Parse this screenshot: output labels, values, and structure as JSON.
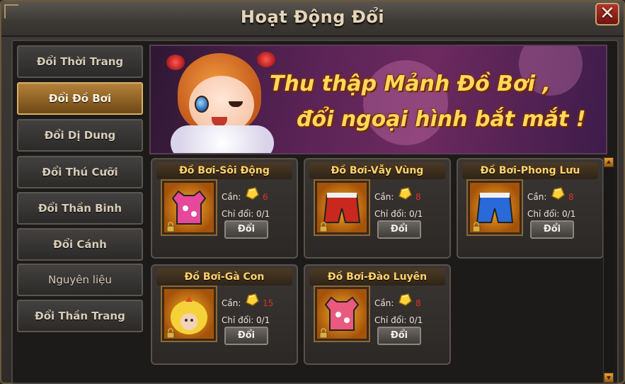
{
  "window": {
    "title": "Hoạt Động Đổi",
    "close_label": "✕"
  },
  "sidebar": {
    "items": [
      {
        "label": "Đổi Thời Trang",
        "active": false
      },
      {
        "label": "Đổi Đồ Bơi",
        "active": true
      },
      {
        "label": "Đổi Dị Dung",
        "active": false
      },
      {
        "label": "Đổi Thú Cưỡi",
        "active": false
      },
      {
        "label": "Đổi Thần Binh",
        "active": false
      },
      {
        "label": "Đổi Cánh",
        "active": false
      },
      {
        "label": "Nguyên liệu",
        "active": false
      },
      {
        "label": "Đổi Thần Trang",
        "active": false
      }
    ]
  },
  "banner": {
    "line1": "Thu thập Mảnh Đồ Bơi ,",
    "line2": "đổi ngoại hình bắt mắt !"
  },
  "labels": {
    "need": "Cần:",
    "limit": "Chỉ đổi:",
    "exchange": "Đổi"
  },
  "items": [
    {
      "name": "Đồ Bơi-Sôi Động",
      "cost": "6",
      "limit": "0/1",
      "icon": "pink-swimsuit-icon",
      "color": "#e6489a"
    },
    {
      "name": "Đồ Bơi-Vẫy Vùng",
      "cost": "8",
      "limit": "0/1",
      "icon": "red-swim-shorts-icon",
      "color": "#c8281e"
    },
    {
      "name": "Đồ Bơi-Phong Lưu",
      "cost": "8",
      "limit": "0/1",
      "icon": "blue-swim-shorts-icon",
      "color": "#2a6ad8"
    },
    {
      "name": "Đồ Bơi-Gà Con",
      "cost": "15",
      "limit": "0/1",
      "icon": "chick-costume-icon",
      "color": "#f5d23a"
    },
    {
      "name": "Đồ Bơi-Đào Luyên",
      "cost": "8",
      "limit": "0/1",
      "icon": "floral-swimsuit-icon",
      "color": "#ea5a7e"
    }
  ],
  "colors": {
    "accent_gold": "#ffd36b",
    "cost_red": "#e0302a",
    "active_tab": "#b5813a"
  }
}
